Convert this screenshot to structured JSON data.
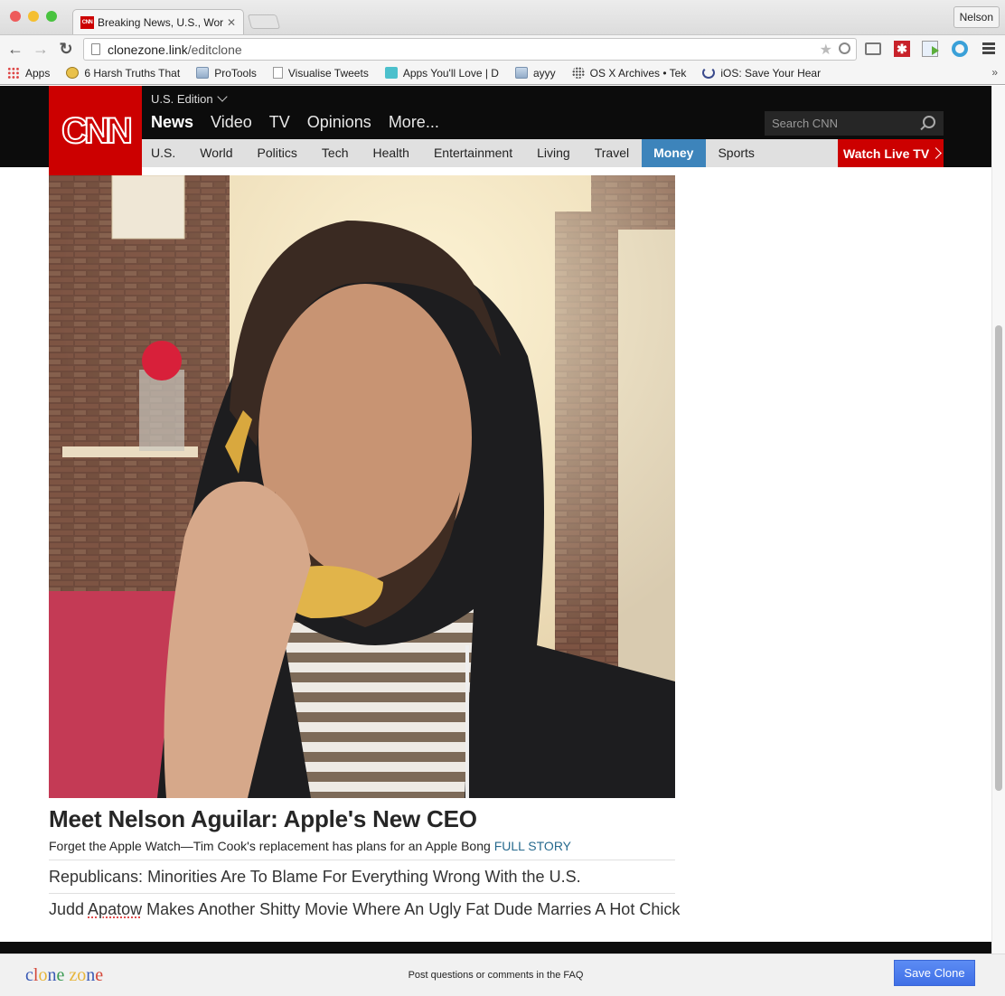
{
  "browser": {
    "tab_title": "Breaking News, U.S., World",
    "tab_favicon": "CNN",
    "profile_name": "Nelson",
    "url_host": "clonezone.link",
    "url_path": "/editclone",
    "bookmarks": [
      {
        "icon": "apps-grid-icon",
        "label": "Apps"
      },
      {
        "icon": "coin-icon",
        "label": "6 Harsh Truths That"
      },
      {
        "icon": "folder-icon",
        "label": "ProTools"
      },
      {
        "icon": "page-icon",
        "label": "Visualise Tweets"
      },
      {
        "icon": "dispatch-icon",
        "label": "Apps You'll Love | D"
      },
      {
        "icon": "folder-icon",
        "label": "ayyy"
      },
      {
        "icon": "globe-icon",
        "label": "OS X Archives • Tek"
      },
      {
        "icon": "power-icon",
        "label": "iOS: Save Your Hear"
      }
    ],
    "bookmarks_overflow": "»"
  },
  "cnn": {
    "logo": "CNN",
    "edition": "U.S. Edition",
    "main_nav": [
      "News",
      "Video",
      "TV",
      "Opinions",
      "More..."
    ],
    "main_nav_active": "News",
    "search_placeholder": "Search CNN",
    "sub_nav": [
      "U.S.",
      "World",
      "Politics",
      "Tech",
      "Health",
      "Entertainment",
      "Living",
      "Travel",
      "Money",
      "Sports"
    ],
    "sub_nav_active": "Money",
    "watch_live": "Watch Live TV",
    "colors": {
      "brand_red": "#cc0000",
      "money_blue": "#3d84bb",
      "link_blue": "#276a8e"
    }
  },
  "article": {
    "hero_alt": "Man in hoodie holding a banana to his ear like a phone",
    "headline": "Meet Nelson Aguilar: Apple's New CEO",
    "teaser": "Forget the Apple Watch—Tim Cook's replacement has plans for an Apple Bong ",
    "teaser_link": "FULL STORY",
    "stories": [
      {
        "pre": "Judd ",
        "spell": "Apatow",
        "post": " Makes Another Shitty Movie Where An Ugly Fat Dude Marries A Hot Chick"
      }
    ],
    "story_1": "Republicans: Minorities Are To Blame For Everything Wrong With the U.S."
  },
  "clonezone": {
    "logo_letters": [
      {
        "ch": "c",
        "color": "#3b5bb5"
      },
      {
        "ch": "l",
        "color": "#d44638"
      },
      {
        "ch": "o",
        "color": "#e7b53a"
      },
      {
        "ch": "n",
        "color": "#3b5bb5"
      },
      {
        "ch": "e",
        "color": "#3a9a52"
      },
      {
        "ch": " ",
        "color": "#000"
      },
      {
        "ch": "z",
        "color": "#e7b53a"
      },
      {
        "ch": "o",
        "color": "#e7b53a"
      },
      {
        "ch": "n",
        "color": "#3b5bb5"
      },
      {
        "ch": "e",
        "color": "#d44638"
      }
    ],
    "message": "Post questions or comments in the FAQ",
    "save_label": "Save Clone"
  }
}
